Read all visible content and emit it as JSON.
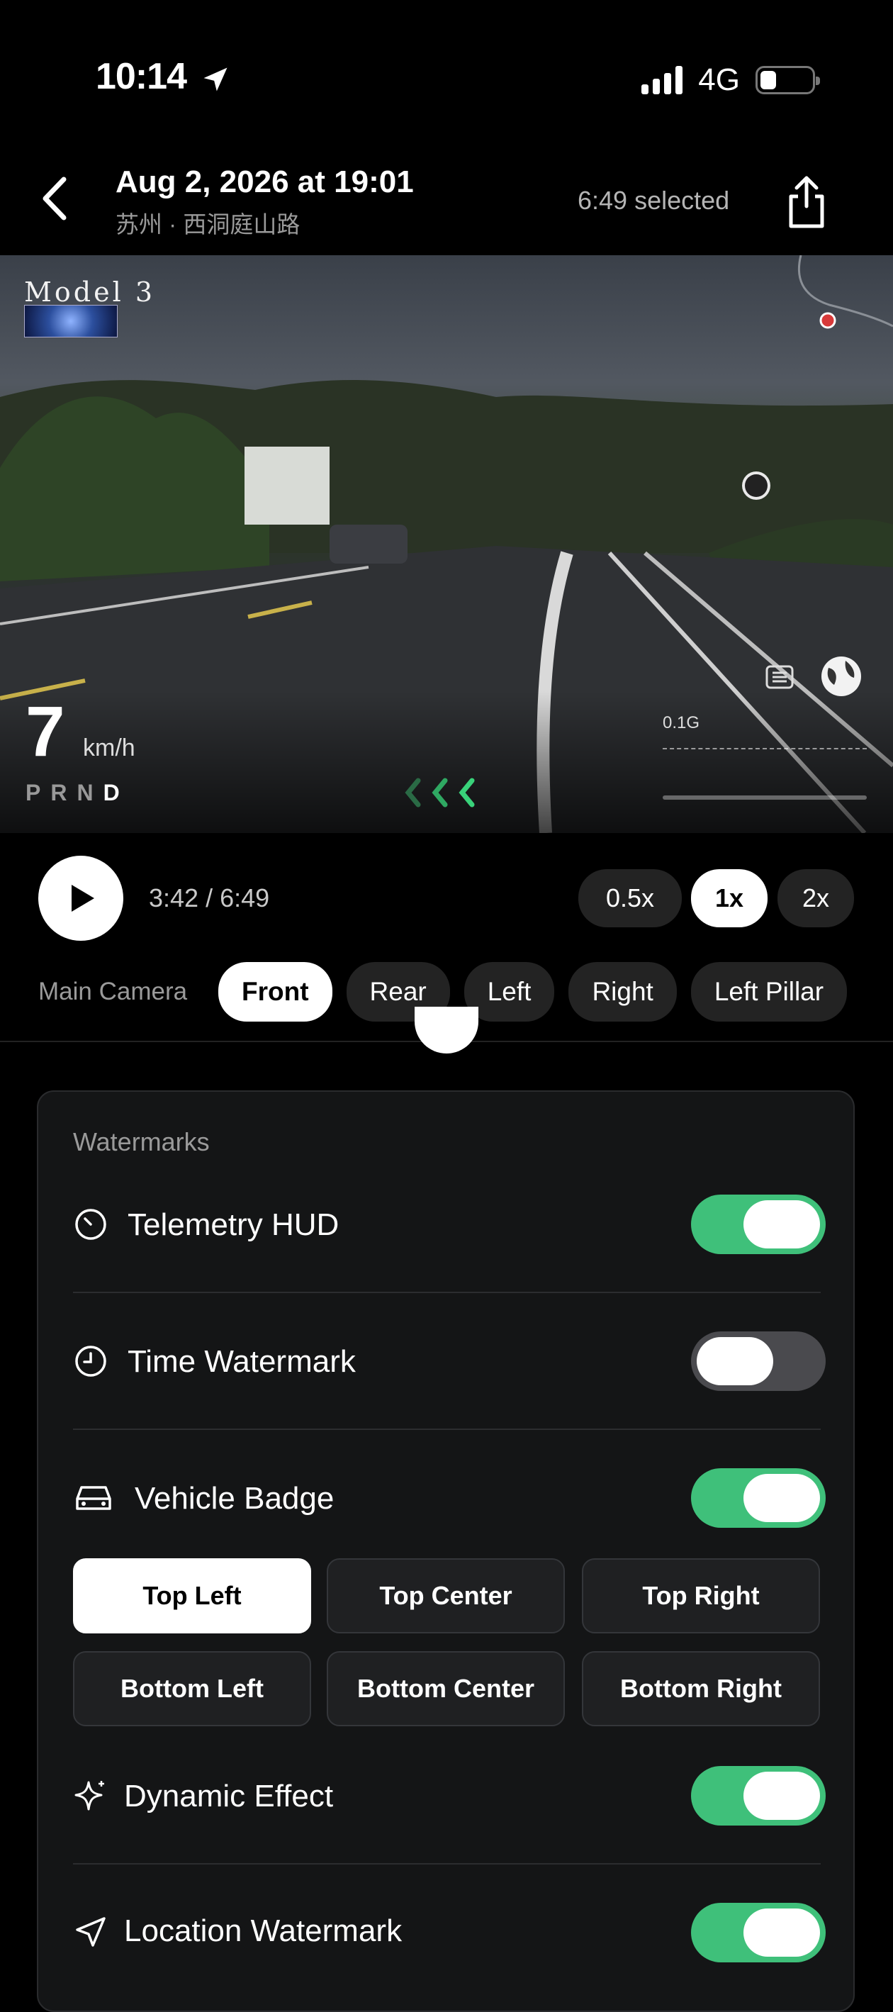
{
  "status_bar": {
    "time": "10:14",
    "network": "4G"
  },
  "header": {
    "title": "Aug 2, 2026 at 19:01",
    "subtitle": "苏州 · 西洞庭山路",
    "selected": "6:49 selected"
  },
  "video": {
    "model_logo": "Model 3",
    "speed": "7",
    "speed_unit": "km/h",
    "gears": [
      "P",
      "R",
      "N",
      "D"
    ],
    "active_gear": "D",
    "g_force_label": "0.1G"
  },
  "playback": {
    "time": "3:42 / 6:49",
    "speeds": [
      {
        "label": "0.5x",
        "selected": false
      },
      {
        "label": "1x",
        "selected": true
      },
      {
        "label": "2x",
        "selected": false
      }
    ]
  },
  "camera": {
    "label": "Main Camera",
    "options": [
      {
        "label": "Front",
        "selected": true
      },
      {
        "label": "Rear",
        "selected": false
      },
      {
        "label": "Left",
        "selected": false
      },
      {
        "label": "Right",
        "selected": false
      },
      {
        "label": "Left Pillar",
        "selected": false
      }
    ]
  },
  "watermarks": {
    "title": "Watermarks",
    "telemetry_hud": {
      "label": "Telemetry HUD",
      "on": true
    },
    "time_watermark": {
      "label": "Time Watermark",
      "on": false
    },
    "vehicle_badge": {
      "label": "Vehicle Badge",
      "on": true
    },
    "positions": [
      "Top Left",
      "Top Center",
      "Top Right",
      "Bottom Left",
      "Bottom Center",
      "Bottom Right"
    ],
    "selected_position": "Top Left",
    "dynamic_effect": {
      "label": "Dynamic Effect",
      "on": true
    },
    "location_watermark": {
      "label": "Location Watermark",
      "on": true
    }
  },
  "colors": {
    "toggle_on": "#3fc07a",
    "toggle_off": "#4a4a4e",
    "accent_green": "#2ecc71"
  }
}
